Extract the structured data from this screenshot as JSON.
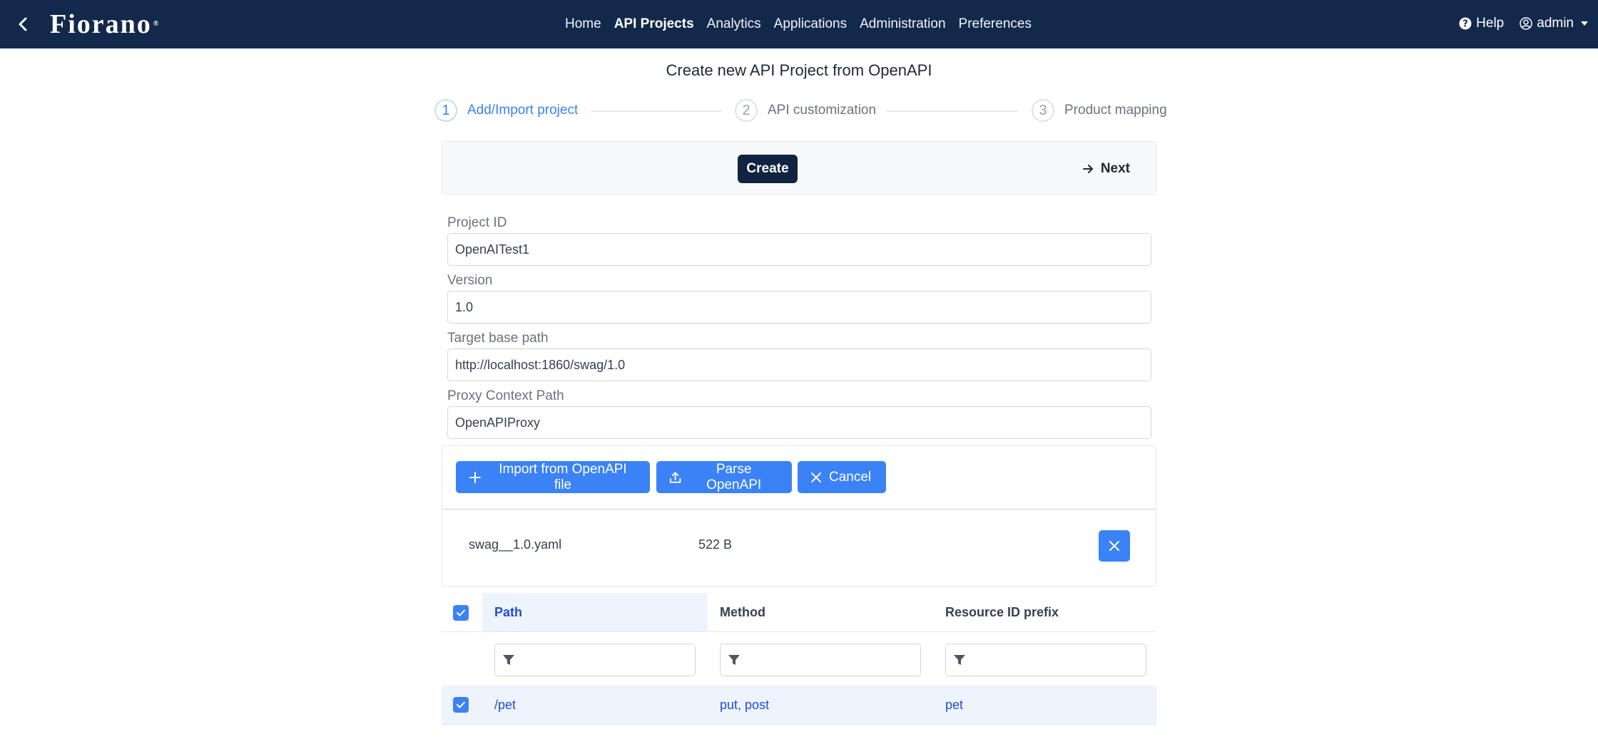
{
  "nav": {
    "brand": "Fiorano",
    "brand_mark": "®",
    "items": [
      {
        "label": "Home",
        "active": false
      },
      {
        "label": "API Projects",
        "active": true
      },
      {
        "label": "Analytics",
        "active": false
      },
      {
        "label": "Applications",
        "active": false
      },
      {
        "label": "Administration",
        "active": false
      },
      {
        "label": "Preferences",
        "active": false
      }
    ],
    "help": "Help",
    "user": "admin",
    "bg_color": "#13294b"
  },
  "page": {
    "title": "Create new API Project from OpenAPI"
  },
  "stepper": [
    {
      "num": "1",
      "label": "Add/Import project",
      "active": true
    },
    {
      "num": "2",
      "label": "API customization",
      "active": false
    },
    {
      "num": "3",
      "label": "Product mapping",
      "active": false
    }
  ],
  "toolbar": {
    "create_label": "Create",
    "next_label": "Next"
  },
  "form": {
    "project_id": {
      "label": "Project ID",
      "value": "OpenAITest1"
    },
    "version": {
      "label": "Version",
      "value": "1.0"
    },
    "target_base_path": {
      "label": "Target base path",
      "value": "http://localhost:1860/swag/1.0"
    },
    "proxy_context_path": {
      "label": "Proxy Context Path",
      "value": "OpenAPIProxy"
    }
  },
  "upload": {
    "import_label": "Import from OpenAPI file",
    "parse_label": "Parse OpenAPI",
    "cancel_label": "Cancel",
    "file": {
      "name": "swag__1.0.yaml",
      "size": "522 B"
    },
    "accent_color": "#3b82f6"
  },
  "table": {
    "headers": {
      "path": "Path",
      "method": "Method",
      "resource_prefix": "Resource ID prefix"
    },
    "rows": [
      {
        "path": "/pet",
        "method": "put, post",
        "resource_prefix": "pet",
        "selected": true
      }
    ]
  }
}
